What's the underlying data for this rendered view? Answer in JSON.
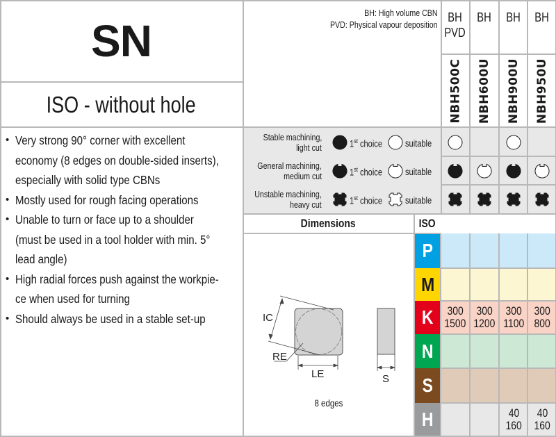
{
  "header": {
    "title": "SN",
    "subtitle": "ISO - without hole",
    "legend_lines": [
      "BH: High volume CBN",
      "PVD: Physical vapour deposition"
    ]
  },
  "features": [
    "Very strong 90° corner with excellent",
    "economy (8 edges on double-sided inserts),",
    "especially with solid type CBNs",
    "Mostly used for rough facing operations",
    "Unable to turn or face up to a shoulder",
    "(must be used in a tool holder with min. 5°",
    "lead angle)",
    "High radial forces push against the workpie-",
    "ce when used for turning",
    "Should always be used in a stable set-up"
  ],
  "feature_bullets": [
    true,
    false,
    false,
    true,
    true,
    false,
    false,
    true,
    false,
    true
  ],
  "grades": [
    {
      "type": [
        "BH",
        "PVD"
      ],
      "code": "NBH500C"
    },
    {
      "type": [
        "BH"
      ],
      "code": "NBH600U"
    },
    {
      "type": [
        "BH"
      ],
      "code": "NBH900U"
    },
    {
      "type": [
        "BH"
      ],
      "code": "NBH950U"
    }
  ],
  "machining": [
    {
      "label": [
        "Stable machining,",
        "light cut"
      ],
      "icon": "circle",
      "cells": [
        "suitable",
        "",
        "suitable",
        ""
      ]
    },
    {
      "label": [
        "General machining,",
        "medium cut"
      ],
      "icon": "notched-circle",
      "cells": [
        "first",
        "suitable",
        "first",
        "suitable"
      ]
    },
    {
      "label": [
        "Unstable machining,",
        "heavy cut"
      ],
      "icon": "cross-notched",
      "cells": [
        "first",
        "first",
        "first",
        "first"
      ]
    }
  ],
  "legend": {
    "first_choice": "1",
    "first_choice_sup": "st",
    "first_choice_rest": " choice",
    "suitable": "suitable"
  },
  "dimensions": {
    "heading": "Dimensions",
    "iso_heading": "ISO",
    "labels": {
      "ic": "IC",
      "re": "RE",
      "le": "LE",
      "s": "S"
    },
    "edges": "8 edges"
  },
  "iso_groups": [
    {
      "letter": "P",
      "color": "#00a0e3",
      "row_color": "#cce9f9",
      "letter_color": "#ffffff",
      "values": [
        [],
        [],
        [],
        []
      ]
    },
    {
      "letter": "M",
      "color": "#ffd500",
      "row_color": "#fdf6d3",
      "letter_color": "#1a1a1a",
      "values": [
        [],
        [],
        [],
        []
      ]
    },
    {
      "letter": "K",
      "color": "#e3001b",
      "row_color": "#f9d3c6",
      "letter_color": "#ffffff",
      "values": [
        [
          "300",
          "1500"
        ],
        [
          "300",
          "1200"
        ],
        [
          "300",
          "1100"
        ],
        [
          "300",
          "800"
        ]
      ]
    },
    {
      "letter": "N",
      "color": "#00a651",
      "row_color": "#cde8d5",
      "letter_color": "#ffffff",
      "values": [
        [],
        [],
        [],
        []
      ]
    },
    {
      "letter": "S",
      "color": "#7b4a1e",
      "row_color": "#e0cbb9",
      "letter_color": "#ffffff",
      "values": [
        [],
        [],
        [],
        []
      ]
    },
    {
      "letter": "H",
      "color": "#9a9b9d",
      "row_color": "#e8e8e8",
      "letter_color": "#ffffff",
      "values": [
        [],
        [],
        [
          "40",
          "160"
        ],
        [
          "40",
          "160"
        ]
      ]
    }
  ]
}
